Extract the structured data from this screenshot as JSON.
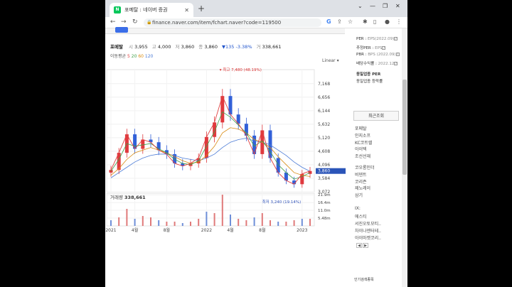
{
  "browser": {
    "tab_title": "포메탈 : 네이버 증권",
    "tab_favicon": "N",
    "url": "finance.naver.com/item/fchart.naver?code=119500"
  },
  "stock": {
    "name": "포메탈",
    "open_label": "시",
    "open": "3,955",
    "high_label": "고",
    "high": "4,000",
    "low_label": "저",
    "low": "3,860",
    "close_label": "종",
    "close": "3,860",
    "change": "▼135 -3.38%",
    "volume_label": "거",
    "volume": "338,661"
  },
  "ma_legend": {
    "label": "이동평균",
    "m5": "5",
    "m20": "20",
    "m60": "60",
    "m120": "120"
  },
  "scale_select": "Linear",
  "volume_title": {
    "label": "거래량",
    "value": "338,661"
  },
  "chart_data": {
    "type": "line",
    "x": [
      "2021-01",
      "2021-02",
      "2021-03",
      "2021-04",
      "2021-05",
      "2021-06",
      "2021-07",
      "2021-08",
      "2021-09",
      "2021-10",
      "2021-11",
      "2021-12",
      "2022-01",
      "2022-02",
      "2022-03",
      "2022-04",
      "2022-05",
      "2022-06",
      "2022-07",
      "2022-08",
      "2022-09",
      "2022-10",
      "2022-11",
      "2022-12",
      "2023-01",
      "2023-02"
    ],
    "close": [
      3900,
      4550,
      5250,
      4700,
      5050,
      4950,
      4650,
      4500,
      4150,
      4050,
      4150,
      4350,
      5150,
      5700,
      6700,
      6000,
      5650,
      5200,
      4500,
      5400,
      4350,
      3800,
      3500,
      3360,
      3750,
      3860
    ],
    "ma20": [
      3850,
      4300,
      4900,
      4800,
      4850,
      4900,
      4700,
      4550,
      4300,
      4150,
      4100,
      4250,
      4800,
      5350,
      6100,
      5900,
      5600,
      5300,
      4800,
      5000,
      4600,
      4100,
      3800,
      3550,
      3650,
      3800
    ],
    "ma60": [
      3700,
      3950,
      4300,
      4550,
      4650,
      4750,
      4650,
      4550,
      4400,
      4250,
      4150,
      4200,
      4450,
      4800,
      5300,
      5500,
      5450,
      5300,
      5050,
      4950,
      4750,
      4400,
      4100,
      3800,
      3700,
      3650
    ],
    "ma120": [
      3600,
      3800,
      4000,
      4200,
      4350,
      4450,
      4500,
      4500,
      4450,
      4350,
      4300,
      4250,
      4350,
      4500,
      4750,
      4950,
      5050,
      5100,
      5000,
      4950,
      4850,
      4650,
      4450,
      4200,
      4000,
      3850
    ],
    "volume_m": [
      4,
      6,
      12,
      5,
      7,
      6,
      4,
      3,
      3,
      2,
      3,
      5,
      10,
      9,
      22,
      8,
      5,
      4,
      6,
      9,
      4,
      3,
      3,
      4,
      5,
      5
    ],
    "price_ticks": [
      "7,168",
      "6,656",
      "6,144",
      "5,632",
      "5,120",
      "4,608",
      "4,096",
      "3,584",
      "3,072"
    ],
    "volume_ticks": [
      "21.9m",
      "16.4m",
      "11.0m",
      "5.48m"
    ],
    "x_tick_labels": [
      "2021",
      "4월",
      "8월",
      "2022",
      "4월",
      "8월",
      "2023"
    ],
    "last_price_badge": "3,860",
    "high_annotation": "최고 7,480 (48.19%)",
    "low_annotation": "최저 3,240 (19.14%)",
    "ylim": [
      3072,
      7700
    ],
    "grid": true
  },
  "right_panel": {
    "metrics": [
      {
        "label": "PER",
        "sub": "EPS(2022.09)"
      },
      {
        "label": "추정PER",
        "sub": "EPS"
      },
      {
        "label": "PBR",
        "sub": "BPS (2022.09)"
      },
      {
        "label": "배당수익률",
        "sub": "2022.12"
      }
    ],
    "same_sector": "동일업종 PER",
    "same_sector_rate": "동일업종 등락률",
    "recent_title": "최근조회",
    "recent_items": [
      "포메탈",
      "인지소프",
      "KC코트렐",
      "아이텍",
      "조선선재",
      "코오롱인더",
      "비덴트",
      "코리즌",
      "제노레이",
      "삼기"
    ],
    "group_items": [
      "IX:",
      "에스티",
      "서진오토모티..",
      "차이나엔터테..",
      "아이마켓코리.."
    ],
    "pager": [
      "◀",
      "▶"
    ],
    "bottom_label": "인기검색종목"
  }
}
